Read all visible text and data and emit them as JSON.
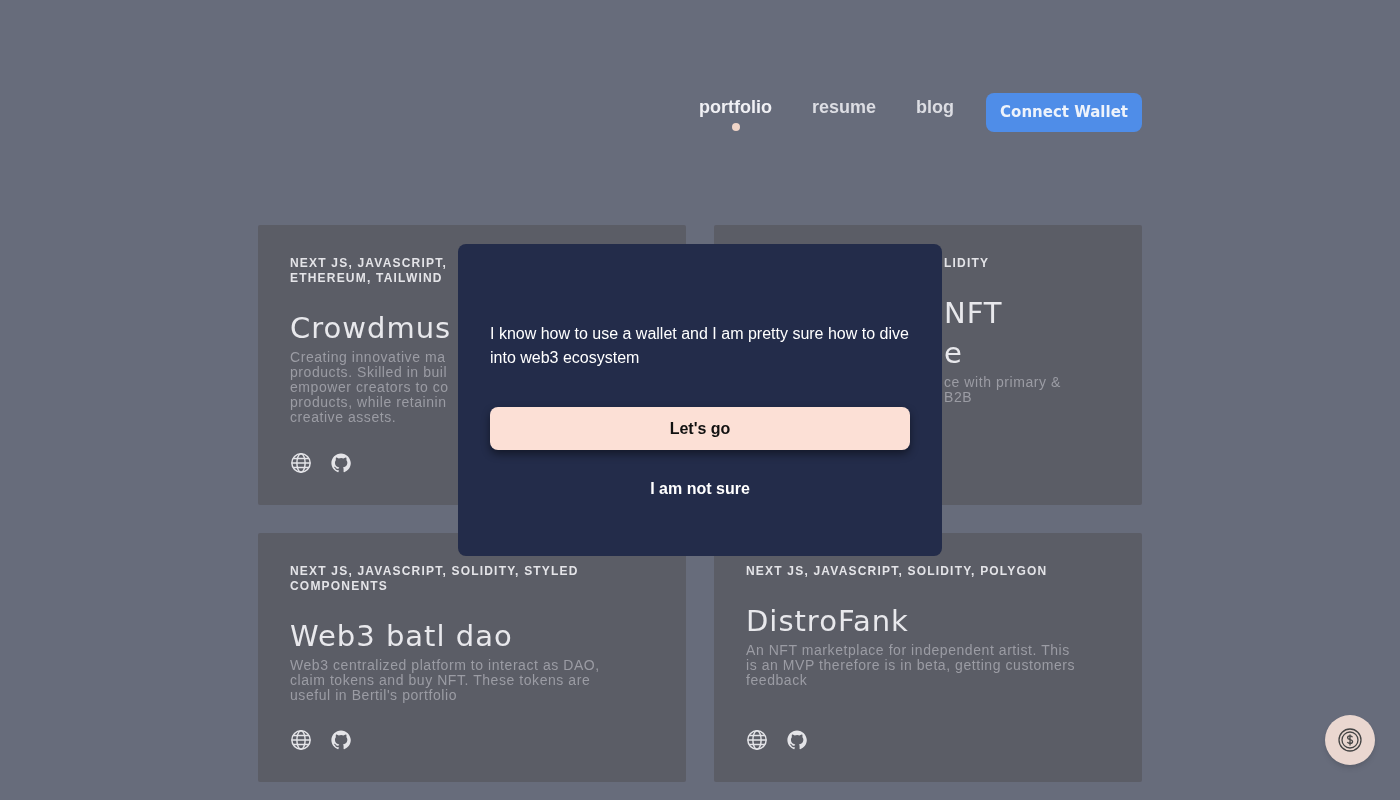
{
  "nav": {
    "items": [
      {
        "label": "portfolio",
        "selected": true
      },
      {
        "label": "resume",
        "selected": false
      },
      {
        "label": "blog",
        "selected": false
      }
    ],
    "wallet_button": "Connect Wallet"
  },
  "cards": [
    {
      "tags": [
        "NEXT JS, JAVASCRIPT,",
        "ETHEREUM, TAILWIND"
      ],
      "title": [
        "Crowdmus"
      ],
      "description": [
        "Creating innovative ma",
        "products. Skilled in buil",
        "empower creators to co",
        "products, while retainin",
        "creative assets."
      ],
      "links": [
        {
          "kind": "website"
        },
        {
          "kind": "github"
        }
      ]
    },
    {
      "tags": [
        "LIDITY"
      ],
      "title": [
        "NFT",
        "e"
      ],
      "description": [
        "ce with primary &",
        "B2B"
      ]
    },
    {
      "tags": [
        "NEXT JS, JAVASCRIPT, SOLIDITY, STYLED",
        "COMPONENTS"
      ],
      "title": [
        "Web3 batl dao"
      ],
      "description": [
        "Web3 centralized platform to interact as DAO,",
        "claim tokens and buy NFT. These tokens are",
        "useful in Bertil's portfolio"
      ],
      "links": [
        {
          "kind": "website"
        },
        {
          "kind": "github"
        }
      ]
    },
    {
      "tags": [
        "NEXT JS, JAVASCRIPT, SOLIDITY, POLYGON"
      ],
      "title": [
        "DistroFank"
      ],
      "description": [
        "An NFT marketplace for independent artist. This",
        "is an MVP therefore is in beta, getting customers",
        "feedback"
      ],
      "links": [
        {
          "kind": "website"
        },
        {
          "kind": "github"
        }
      ]
    }
  ],
  "modal": {
    "message": "I know how to use a wallet and I am pretty sure how to dive into web3 ecosystem",
    "primary_button": "Let's go",
    "secondary_button": "I am not sure"
  }
}
